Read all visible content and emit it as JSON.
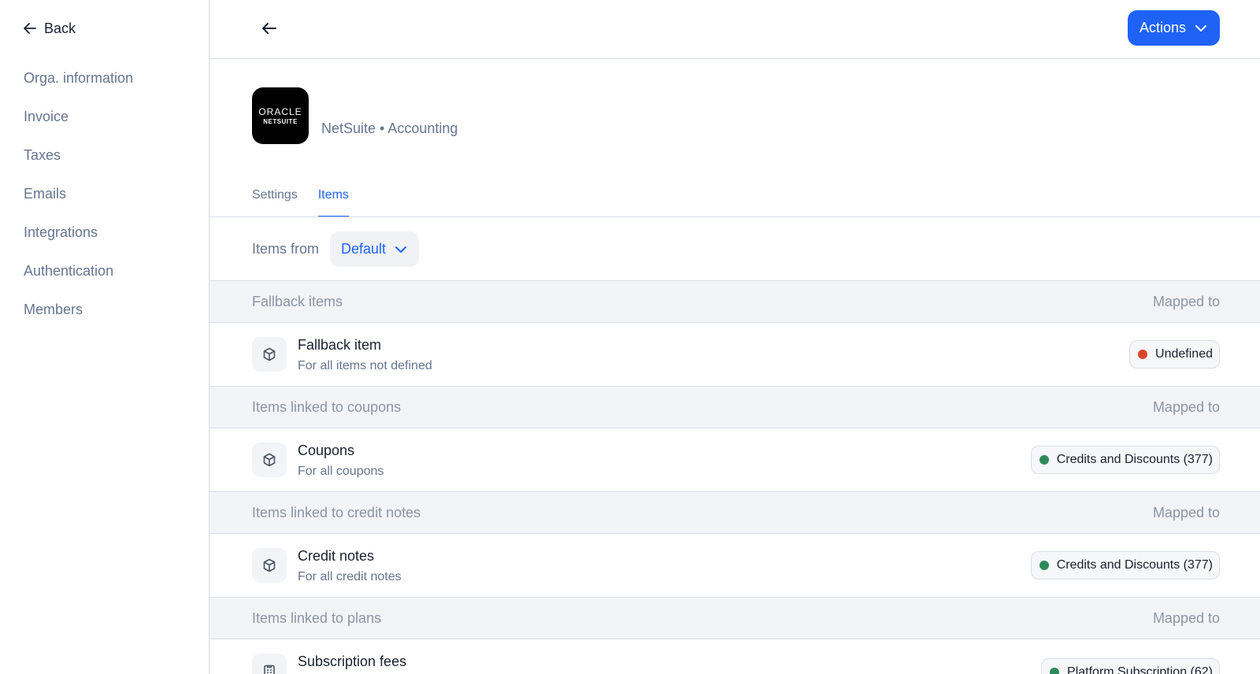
{
  "sidebar": {
    "back_label": "Back",
    "items": [
      {
        "label": "Orga. information"
      },
      {
        "label": "Invoice"
      },
      {
        "label": "Taxes"
      },
      {
        "label": "Emails"
      },
      {
        "label": "Integrations"
      },
      {
        "label": "Authentication"
      },
      {
        "label": "Members"
      }
    ]
  },
  "header": {
    "actions_label": "Actions"
  },
  "integration": {
    "logo_line1": "ORACLE",
    "logo_line2": "NETSUITE",
    "subtitle": "NetSuite • Accounting"
  },
  "tabs": [
    {
      "label": "Settings",
      "active": false
    },
    {
      "label": "Items",
      "active": true
    }
  ],
  "filter": {
    "label": "Items from",
    "selected": "Default"
  },
  "sections": [
    {
      "title": "Fallback items",
      "mapped_label": "Mapped to",
      "row": {
        "name": "Fallback item",
        "desc": "For all items not defined",
        "mapping": "Undefined",
        "status_color": "#d9442b",
        "icon": "box-icon"
      }
    },
    {
      "title": "Items linked to coupons",
      "mapped_label": "Mapped to",
      "row": {
        "name": "Coupons",
        "desc": "For all coupons",
        "mapping": "Credits and Discounts (377)",
        "status_color": "#2f8a5b",
        "icon": "box-icon"
      }
    },
    {
      "title": "Items linked to credit notes",
      "mapped_label": "Mapped to",
      "row": {
        "name": "Credit notes",
        "desc": "For all credit notes",
        "mapping": "Credits and Discounts (377)",
        "status_color": "#2f8a5b",
        "icon": "box-icon"
      }
    },
    {
      "title": "Items linked to plans",
      "mapped_label": "Mapped to",
      "row": {
        "name": "Subscription fees",
        "desc": "",
        "mapping": "Platform Subscription (62)",
        "status_color": "#2f8a5b",
        "icon": "clipboard-icon"
      }
    }
  ]
}
